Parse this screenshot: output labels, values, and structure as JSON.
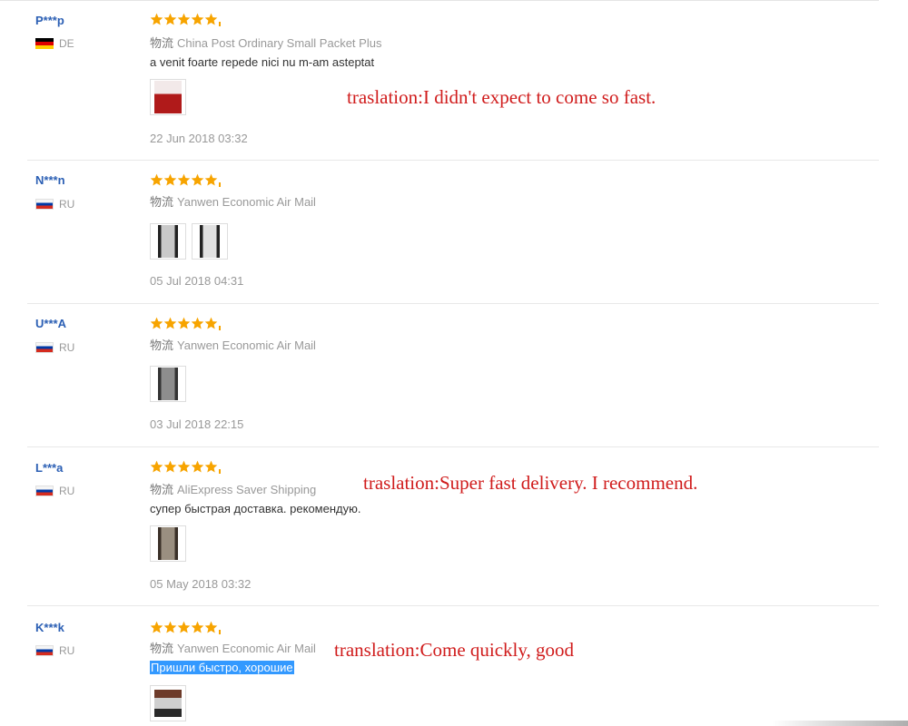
{
  "shipping_prefix": "物流",
  "colors": {
    "star": "#f7a400",
    "username": "#2b5fb4",
    "annotation": "#d01c1c",
    "highlight": "#3399ff"
  },
  "reviews": [
    {
      "user": "P***p",
      "country": "DE",
      "flag": "flag-de",
      "stars": 5,
      "shipping": "China Post Ordinary Small Packet Plus",
      "comment": "a venit foarte repede nici nu m-am asteptat",
      "photo_count": 1,
      "date": "22 Jun 2018 03:32"
    },
    {
      "user": "N***n",
      "country": "RU",
      "flag": "flag-ru",
      "stars": 5,
      "shipping": "Yanwen Economic Air Mail",
      "comment": "",
      "photo_count": 2,
      "date": "05 Jul 2018 04:31"
    },
    {
      "user": "U***A",
      "country": "RU",
      "flag": "flag-ru",
      "stars": 5,
      "shipping": "Yanwen Economic Air Mail",
      "comment": "",
      "photo_count": 1,
      "date": "03 Jul 2018 22:15"
    },
    {
      "user": "L***a",
      "country": "RU",
      "flag": "flag-ru",
      "stars": 5,
      "shipping": "AliExpress Saver Shipping",
      "comment": "супер быстрая доставка. рекомендую.",
      "photo_count": 1,
      "date": "05 May 2018 03:32"
    },
    {
      "user": "K***k",
      "country": "RU",
      "flag": "flag-ru",
      "stars": 5,
      "shipping": "Yanwen Economic Air Mail",
      "comment": "Пришли быстро, хорошие",
      "photo_count": 1,
      "date": ""
    }
  ],
  "annotations": [
    "traslation:I didn't expect to come so fast.",
    "traslation:Super fast delivery. I recommend.",
    "translation:Come quickly, good"
  ]
}
